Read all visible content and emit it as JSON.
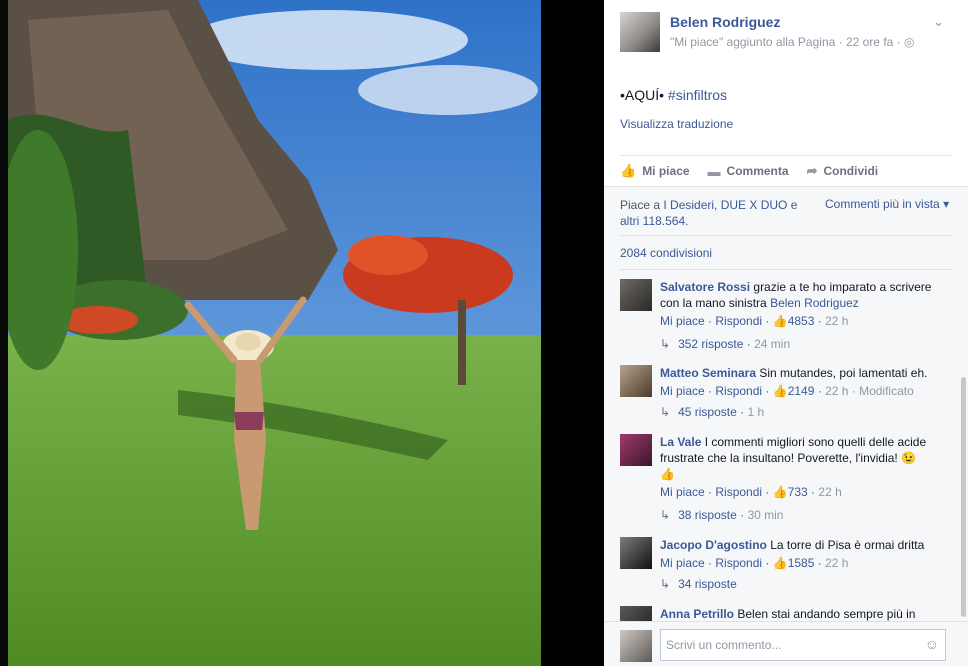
{
  "post": {
    "author": "Belen Rodriguez",
    "meta": "\"Mi piace\" aggiunto alla Pagina · 22 ore fa ·",
    "text_prefix": "•AQUÍ• ",
    "hashtag": "#sinfiltros",
    "translate": "Visualizza traduzione",
    "actions": {
      "like": "Mi piace",
      "comment": "Commenta",
      "share": "Condividi"
    },
    "likes_prefix": "Piace a ",
    "liker1": "I Desideri",
    "comma": ", ",
    "liker2": "DUE X DUO",
    "and": " e",
    "others": "altri 118.564",
    "period": ".",
    "relevant": "Commenti più in vista",
    "shares": "2084 condivisioni"
  },
  "comments": [
    {
      "name": "Salvatore Rossi",
      "text": "grazie a te ho imparato a scrivere con la mano sinistra",
      "tag": "Belen Rodriguez",
      "like": "Mi piace",
      "reply": "Rispondi",
      "count": "4853",
      "time": "22 h",
      "replies": "352 risposte",
      "reply_time": "24 min"
    },
    {
      "name": "Matteo Seminara",
      "text": "Sin mutandes, poi lamentati eh.",
      "like": "Mi piace",
      "reply": "Rispondi",
      "count": "2149",
      "time": "22 h · Modificato",
      "replies": "45 risposte",
      "reply_time": "1 h"
    },
    {
      "name": "La Vale",
      "text": "I commenti migliori sono quelli delle acide frustrate che la insultano! Poverette, l'invidia!",
      "like": "Mi piace",
      "reply": "Rispondi",
      "count": "733",
      "time": "22 h",
      "replies": "38 risposte",
      "reply_time": "30 min"
    },
    {
      "name": "Jacopo D'agostino",
      "text": "La torre di Pisa è ormai dritta",
      "like": "Mi piace",
      "reply": "Rispondi",
      "count": "1585",
      "time": "22 h",
      "replies": "34 risposte"
    },
    {
      "name": "Anna Petrillo",
      "text": "Belen stai andando sempre più in"
    }
  ],
  "composer": {
    "placeholder": "Scrivi un commento..."
  },
  "icons": {
    "chevron": "chevron-down-icon",
    "globe": "globe-icon",
    "like": "thumbs-up-icon",
    "comment": "speech-bubble-icon",
    "share": "share-arrow-icon",
    "smiley": "smiley-icon"
  },
  "colors": {
    "link": "#3b5998",
    "muted": "#9197a3"
  }
}
